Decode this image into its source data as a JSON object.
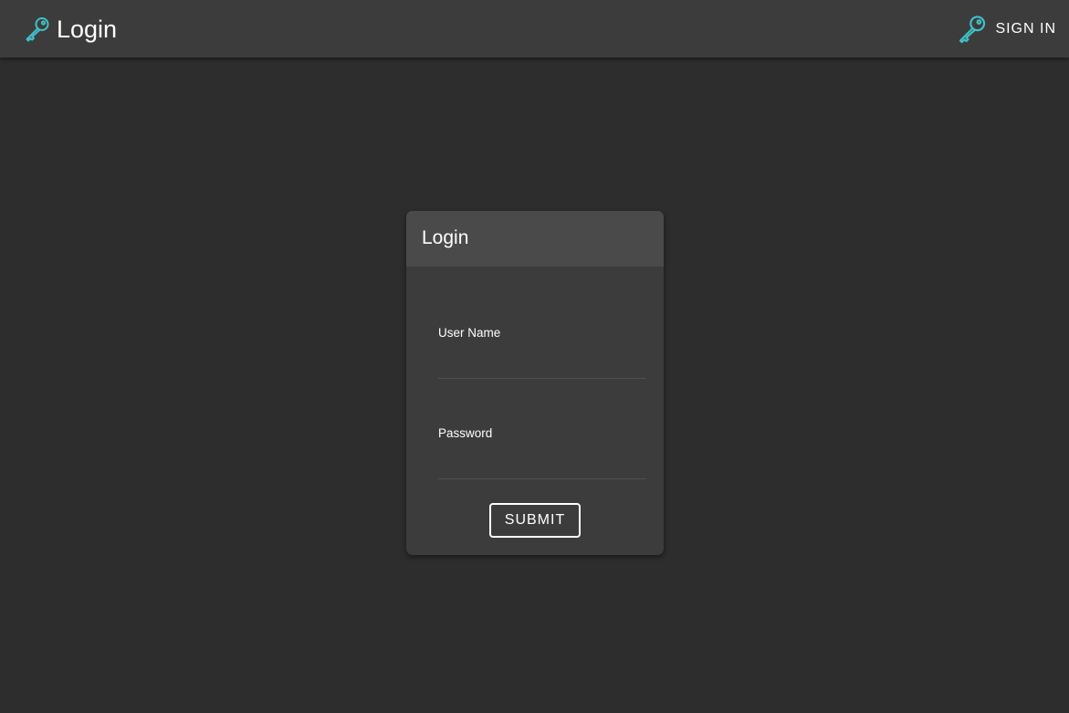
{
  "appbar": {
    "title": "Login",
    "brand_icon": "key-icon",
    "signin_label": "SIGN IN",
    "signin_icon": "key-icon",
    "accent_color": "#3fc1c9"
  },
  "login_card": {
    "header": "Login",
    "username_label": "User Name",
    "username_value": "",
    "password_label": "Password",
    "password_value": "",
    "submit_label": "SUBMIT"
  }
}
